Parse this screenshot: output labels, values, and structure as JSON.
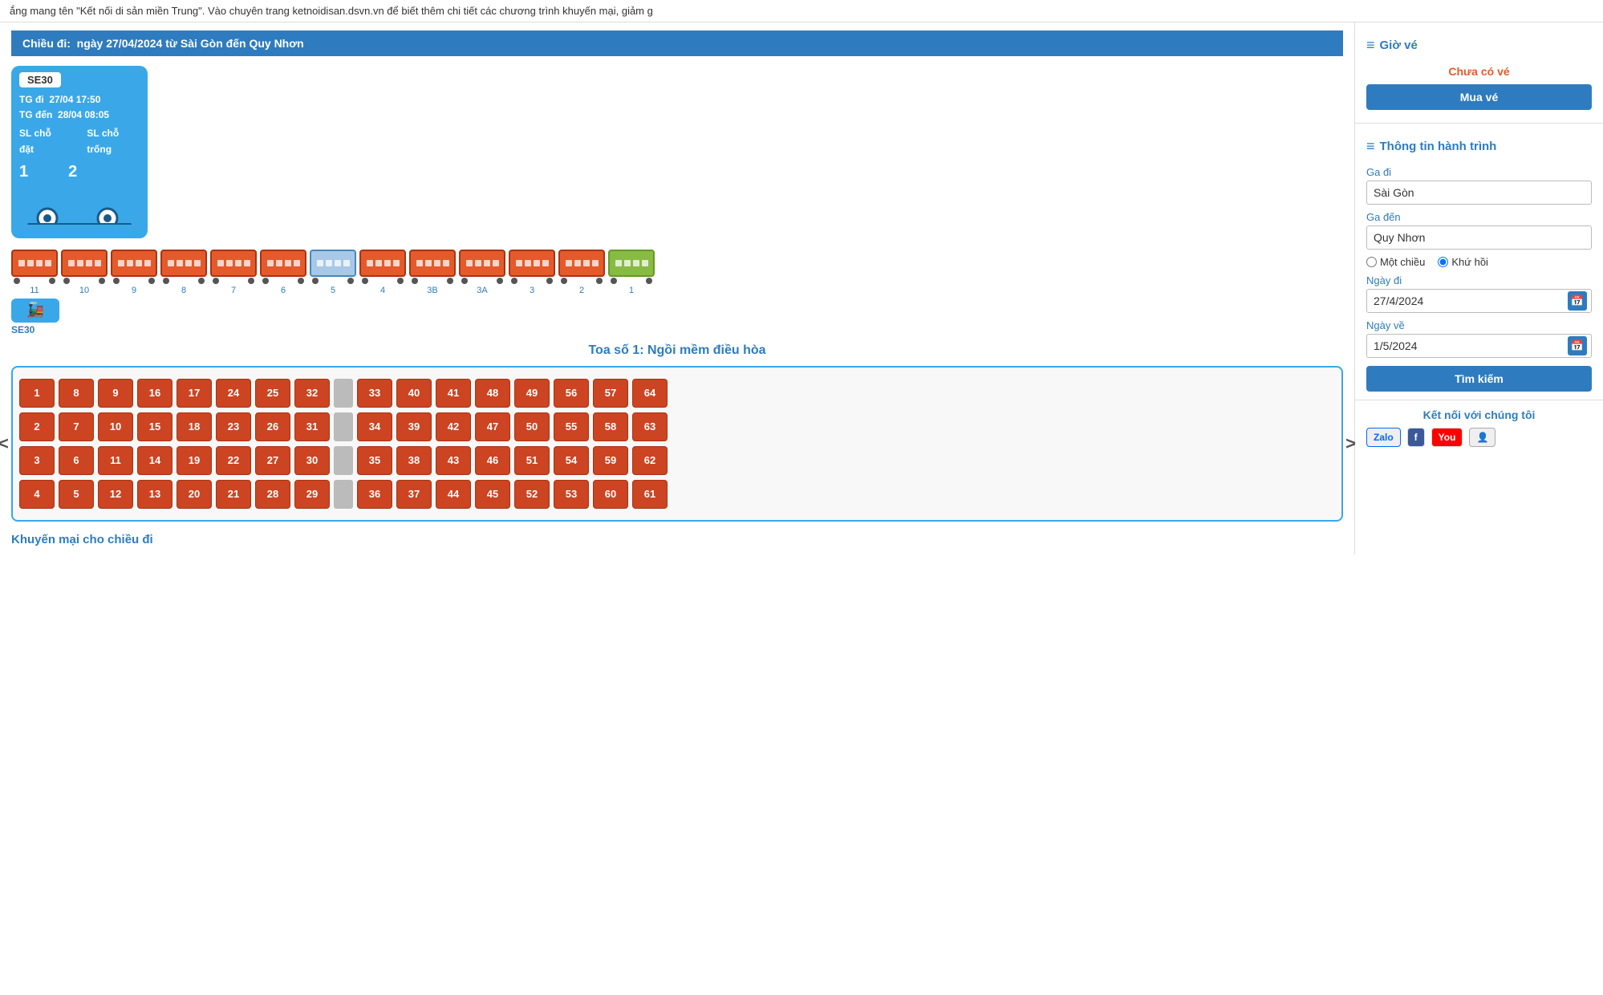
{
  "banner": {
    "text": "ắng mang tên \"Kết nối di sản miền Trung\". Vào chuyên trang ketnoidisan.dsvn.vn để biết thêm chi tiết các chương trình khuyến mại, giảm g"
  },
  "direction": {
    "label": "Chiều đi:",
    "detail": "ngày 27/04/2024 từ Sài Gòn đến Quy Nhơn"
  },
  "train_card": {
    "number": "SE30",
    "depart_label": "TG đi",
    "depart_time": "27/04 17:50",
    "arrive_label": "TG đến",
    "arrive_time": "28/04 08:05",
    "seat_booked_label": "SL chỗ đặt",
    "seat_avail_label": "SL chỗ trống",
    "seat_booked": "1",
    "seat_avail": "2"
  },
  "wagons": [
    {
      "id": "11",
      "type": "red"
    },
    {
      "id": "10",
      "type": "red"
    },
    {
      "id": "9",
      "type": "red"
    },
    {
      "id": "8",
      "type": "red"
    },
    {
      "id": "7",
      "type": "red"
    },
    {
      "id": "6",
      "type": "red"
    },
    {
      "id": "5",
      "type": "blue"
    },
    {
      "id": "4",
      "type": "red"
    },
    {
      "id": "3B",
      "type": "red"
    },
    {
      "id": "3A",
      "type": "red"
    },
    {
      "id": "3",
      "type": "red"
    },
    {
      "id": "2",
      "type": "red"
    },
    {
      "id": "1",
      "type": "green"
    }
  ],
  "small_train_label": "SE30",
  "seat_map_title": "Toa số 1: Ngồi mềm điều hòa",
  "seat_rows": {
    "row1": [
      1,
      8,
      9,
      16,
      17,
      24,
      25,
      32,
      "DIV",
      33,
      40,
      41,
      48,
      49,
      56,
      57,
      64
    ],
    "row2": [
      2,
      7,
      10,
      15,
      18,
      23,
      26,
      31,
      "DIV",
      34,
      39,
      42,
      47,
      50,
      55,
      58,
      63
    ],
    "row3": [
      3,
      6,
      11,
      14,
      19,
      22,
      27,
      30,
      "DIV",
      35,
      38,
      43,
      46,
      51,
      54,
      59,
      62
    ],
    "row4": [
      4,
      5,
      12,
      13,
      20,
      21,
      28,
      29,
      "DIV",
      36,
      37,
      44,
      45,
      52,
      53,
      60,
      61
    ]
  },
  "promo_title": "Khuyến mại cho chiều đi",
  "right_panel": {
    "gio_ve_title": "Giờ vé",
    "no_ticket_text": "Chưa có vé",
    "buy_btn": "Mua vé",
    "hanh_trinh_title": "Thông tin hành trình",
    "ga_di_label": "Ga đi",
    "ga_di_value": "Sài Gòn",
    "ga_den_label": "Ga đến",
    "ga_den_value": "Quy Nhơn",
    "radio_one_way": "Một chiều",
    "radio_round_trip": "Khứ hồi",
    "ngay_di_label": "Ngày đi",
    "ngay_di_value": "27/4/2024",
    "ngay_ve_label": "Ngày về",
    "ngay_ve_value": "1/5/2024",
    "search_btn": "Tìm kiếm",
    "connect_title": "Kết nối với chúng tôi",
    "social": [
      {
        "label": "Zalo",
        "type": "zalo"
      },
      {
        "label": "f",
        "type": "facebook"
      },
      {
        "label": "You",
        "type": "youtube"
      },
      {
        "label": "👤",
        "type": "user-icon"
      }
    ]
  }
}
